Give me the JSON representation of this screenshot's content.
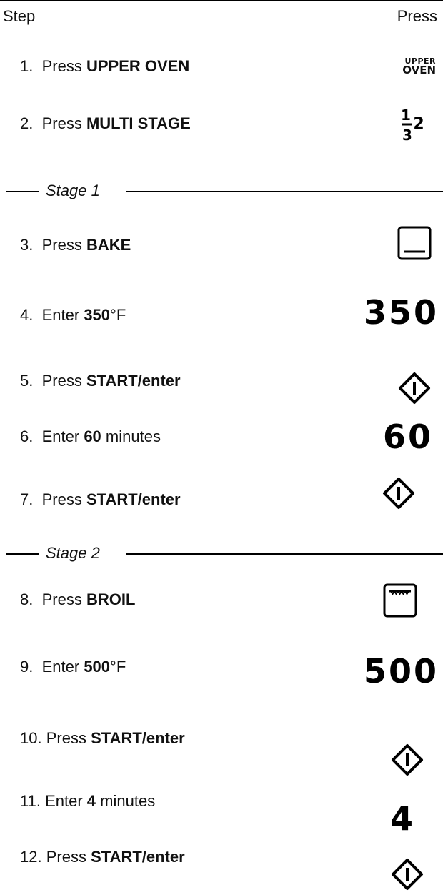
{
  "header": {
    "step_label": "Step",
    "press_label": "Press"
  },
  "stage1": {
    "label": "Stage 1"
  },
  "stage2": {
    "label": "Stage 2"
  },
  "steps": [
    {
      "num": "1.",
      "action": "Press",
      "bold": "UPPER OVEN",
      "suffix": ""
    },
    {
      "num": "2.",
      "action": "Press",
      "bold": "MULTI STAGE",
      "suffix": ""
    },
    {
      "num": "3.",
      "action": "Press",
      "bold": "BAKE",
      "suffix": ""
    },
    {
      "num": "4.",
      "action": "Enter",
      "bold": "350",
      "suffix": "°F"
    },
    {
      "num": "5.",
      "action": "Press",
      "bold": "START/enter",
      "suffix": ""
    },
    {
      "num": "6.",
      "action": "Enter",
      "bold": "60",
      "suffix": " minutes"
    },
    {
      "num": "7.",
      "action": "Press",
      "bold": "START/enter",
      "suffix": ""
    },
    {
      "num": "8.",
      "action": "Press",
      "bold": "BROIL",
      "suffix": ""
    },
    {
      "num": "9.",
      "action": "Enter",
      "bold": "500",
      "suffix": "°F"
    },
    {
      "num": "10.",
      "action": "Press",
      "bold": "START/enter",
      "suffix": ""
    },
    {
      "num": "11.",
      "action": "Enter",
      "bold": "4",
      "suffix": " minutes"
    },
    {
      "num": "12.",
      "action": "Press",
      "bold": "START/enter",
      "suffix": ""
    }
  ],
  "keys": {
    "upper_oven_line1": "UPPER",
    "upper_oven_line2": "OVEN",
    "multi_stage_1": "1",
    "multi_stage_2": "2",
    "multi_stage_3": "3",
    "temp_350": "350",
    "time_60": "60",
    "temp_500": "500",
    "time_4": "4"
  },
  "icons": {
    "upper_oven": "upper-oven-key-icon",
    "multi_stage": "multi-stage-key-icon",
    "bake": "bake-key-icon",
    "broil": "broil-key-icon",
    "start": "start-enter-key-icon"
  }
}
